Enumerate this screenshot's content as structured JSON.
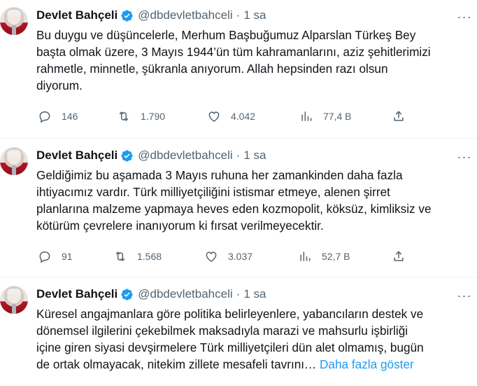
{
  "colors": {
    "text": "#0f1419",
    "muted": "#536471",
    "link": "#1d9bf0",
    "verified": "#1d9bf0",
    "divider": "#eff3f4"
  },
  "icons": {
    "reply": "reply-icon",
    "retweet": "retweet-icon",
    "like": "heart-icon",
    "views": "views-icon",
    "share": "share-icon",
    "more": "more-icon",
    "verified": "verified-badge-icon"
  },
  "tweets": [
    {
      "name": "Devlet Bahçeli",
      "handle": "@dbdevletbahceli",
      "dot": "·",
      "time": "1 sa",
      "more": "···",
      "text": "Bu duygu ve düşüncelerle, Merhum Başbuğumuz Alparslan Türkeş Bey\nbaşta olmak üzere, 3 Mayıs 1944’ün tüm kahramanlarını, aziz şehitlerimizi\nrahmetle, minnetle, şükranla anıyorum. Allah hepsinden razı olsun\ndiyorum.",
      "show_more": "",
      "replies": "146",
      "retweets": "1.790",
      "likes": "4.042",
      "views": "77,4 B"
    },
    {
      "name": "Devlet Bahçeli",
      "handle": "@dbdevletbahceli",
      "dot": "·",
      "time": "1 sa",
      "more": "···",
      "text": "Geldiğimiz bu aşamada 3 Mayıs ruhuna her zamankinden daha fazla\nihtiyacımız vardır. Türk milliyetçiliğini istismar etmeye, alenen şirret\nplanlarına malzeme yapmaya heves eden kozmopolit, köksüz, kimliksiz ve\nkötürüm çevrelere inanıyorum ki fırsat verilmeyecektir.",
      "show_more": "",
      "replies": "91",
      "retweets": "1.568",
      "likes": "3.037",
      "views": "52,7 B"
    },
    {
      "name": "Devlet Bahçeli",
      "handle": "@dbdevletbahceli",
      "dot": "·",
      "time": "1 sa",
      "more": "···",
      "text": "Küresel angajmanlara göre politika belirleyenlere, yabancıların destek ve\ndönemsel ilgilerini çekebilmek maksadıyla marazi ve mahsurlu işbirliği\niçine giren siyasi devşirmelere Türk milliyetçileri dün alet olmamış, bugün\nde ortak olmayacak, nitekim zillete mesafeli tavrını… ",
      "show_more": "Daha fazla göster",
      "replies": "",
      "retweets": "",
      "likes": "",
      "views": ""
    }
  ]
}
